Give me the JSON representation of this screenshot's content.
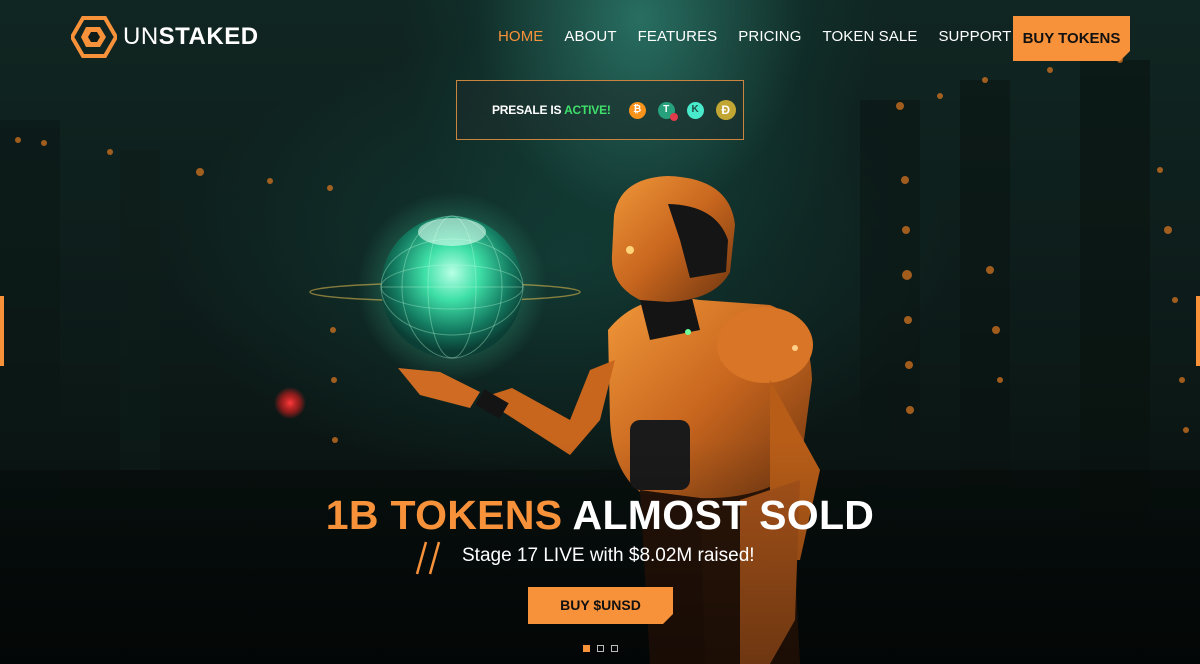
{
  "brand": {
    "name_prefix": "UN",
    "name_suffix": "STAKED",
    "logo_icon": "hexagon-logo-icon",
    "accent_color": "#f7923a"
  },
  "nav": {
    "items": [
      {
        "label": "HOME",
        "active": true
      },
      {
        "label": "ABOUT",
        "active": false
      },
      {
        "label": "FEATURES",
        "active": false
      },
      {
        "label": "PRICING",
        "active": false
      },
      {
        "label": "TOKEN SALE",
        "active": false
      },
      {
        "label": "SUPPORT",
        "active": false
      }
    ],
    "cta_label": "BUY TOKENS"
  },
  "presale": {
    "text": "PRESALE IS",
    "status": "ACTIVE!",
    "status_color": "#3ee06a",
    "coins": [
      "bitcoin-icon",
      "tether-icon",
      "kaspa-icon",
      "dogecoin-icon"
    ]
  },
  "hero": {
    "headline_accent": "1B TOKENS",
    "headline_rest": "ALMOST SOLD",
    "subline": "Stage 17 LIVE with $8.02M raised!",
    "cta_label": "BUY $UNSD",
    "image": "orange-robot-holding-glowing-globe"
  },
  "slider": {
    "count": 3,
    "active_index": 0
  }
}
